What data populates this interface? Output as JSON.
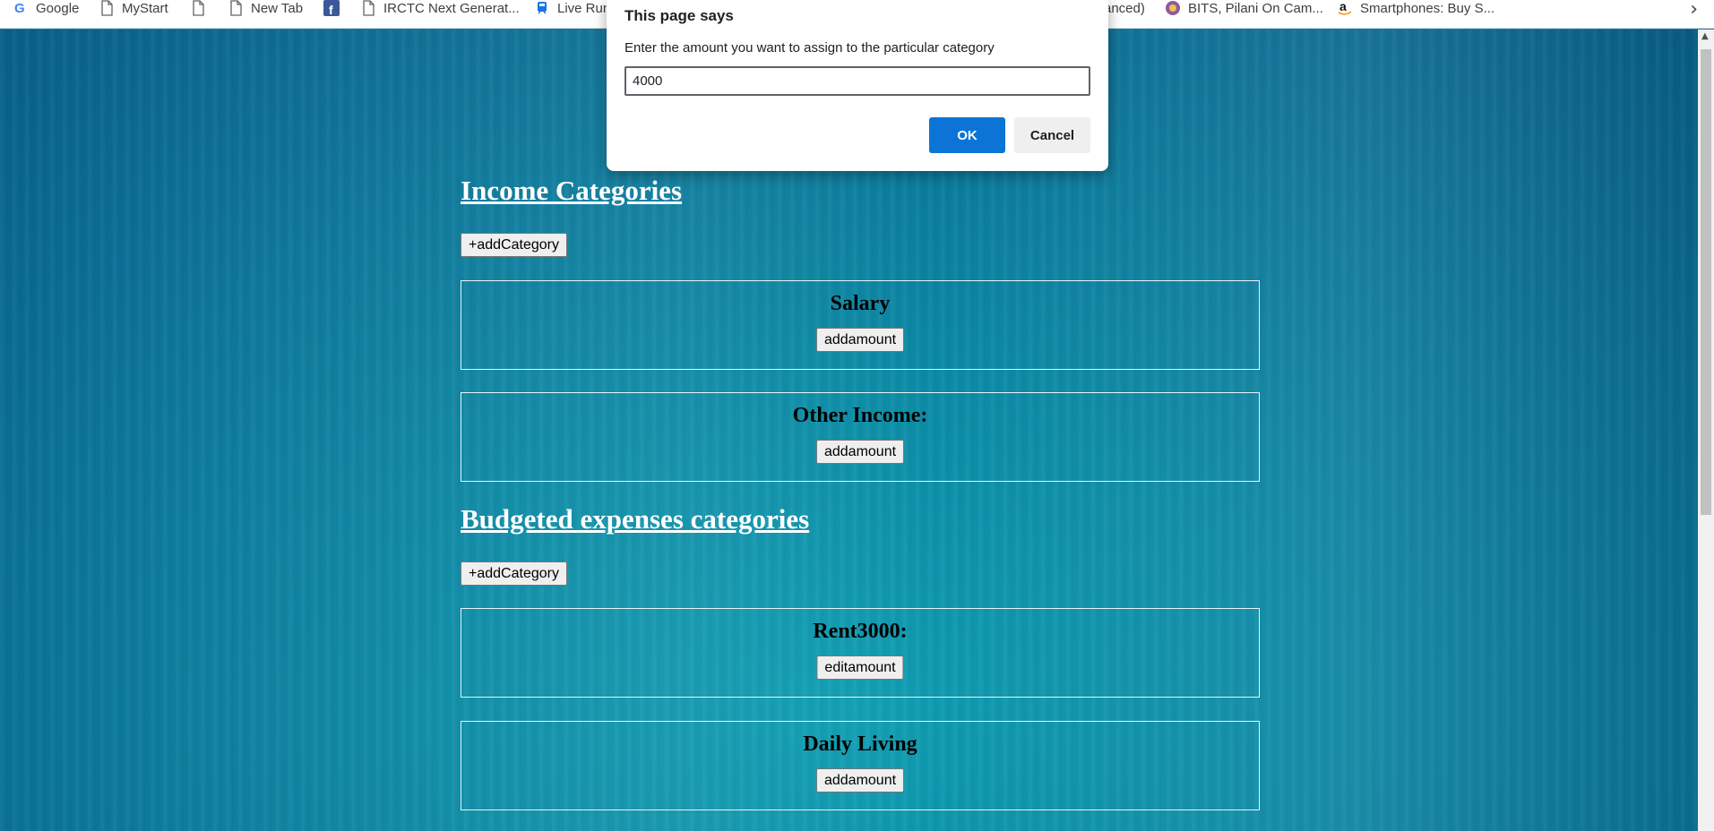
{
  "bookmarks": [
    {
      "label": "Google",
      "icon": "google-icon"
    },
    {
      "label": "MyStart",
      "icon": "page-icon"
    },
    {
      "label": "",
      "icon": "page-icon"
    },
    {
      "label": "New Tab",
      "icon": "page-icon"
    },
    {
      "label": "",
      "icon": "facebook-icon"
    },
    {
      "label": "IRCTC Next Generat...",
      "icon": "page-icon"
    },
    {
      "label": "Live Run",
      "icon": "train-icon"
    },
    {
      "label": "anced)",
      "icon": ""
    },
    {
      "label": "BITS, Pilani On Cam...",
      "icon": "bits-icon"
    },
    {
      "label": "Smartphones: Buy S...",
      "icon": "amazon-icon"
    }
  ],
  "income": {
    "title": "Income Categories",
    "add_label": "+addCategory",
    "cards": [
      {
        "name": "Salary",
        "button": "addamount"
      },
      {
        "name": "Other Income:",
        "button": "addamount"
      }
    ]
  },
  "expenses": {
    "title": "Budgeted expenses categories",
    "add_label": "+addCategory",
    "cards": [
      {
        "name": "Rent3000:",
        "button": "editamount"
      },
      {
        "name": "Daily Living",
        "button": "addamount"
      }
    ]
  },
  "dialog": {
    "title": "This page says",
    "message": "Enter the amount you want to assign to the particular category",
    "input_value": "4000",
    "ok_label": "OK",
    "cancel_label": "Cancel"
  },
  "colors": {
    "background": "#0a7f9e",
    "ok_button": "#0b74d6"
  }
}
